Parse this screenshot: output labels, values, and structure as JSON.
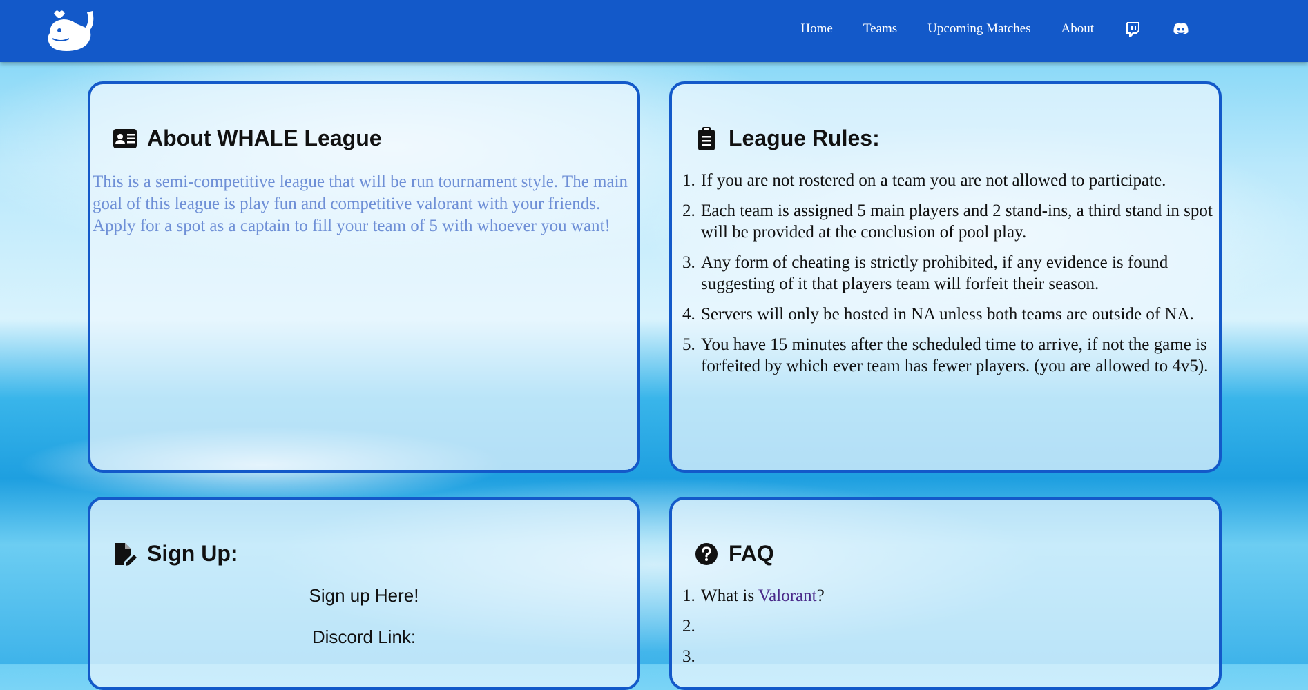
{
  "nav": {
    "logo_icon": "whale-icon",
    "links": [
      "Home",
      "Teams",
      "Upcoming Matches",
      "About"
    ],
    "social_icons": [
      "twitch-icon",
      "discord-icon"
    ],
    "bar_color": "#1359c9"
  },
  "about": {
    "title": "About WHALE League",
    "icon": "id-card-icon",
    "text": "This is a semi-competitive league that will be run tournament style. The main goal of this league is play fun and competitive valorant with your friends. Apply for a spot as a captain to fill your team of 5 with whoever you want!"
  },
  "rules": {
    "title": "League Rules:",
    "icon": "clipboard-icon",
    "items": [
      "If you are not rostered on a team you are not allowed to participate.",
      "Each team is assigned 5 main players and 2 stand-ins, a third stand in spot will be provided at the conclusion of pool play.",
      "Any form of cheating is strictly prohibited, if any evidence is found suggesting of it that players team will forfeit their season.",
      "Servers will only be hosted in NA unless both teams are outside of NA.",
      "You have 15 minutes after the scheduled time to arrive, if not the game is forfeited by which ever team has fewer players. (you are allowed to 4v5)."
    ]
  },
  "signup": {
    "title": "Sign Up:",
    "icon": "file-pen-icon",
    "link_text": "Sign up Here!",
    "discord_label": "Discord Link:"
  },
  "faq": {
    "title": "FAQ",
    "icon": "question-circle-icon",
    "q1_prefix": "What is ",
    "q1_link": "Valorant",
    "q1_suffix": "?"
  }
}
